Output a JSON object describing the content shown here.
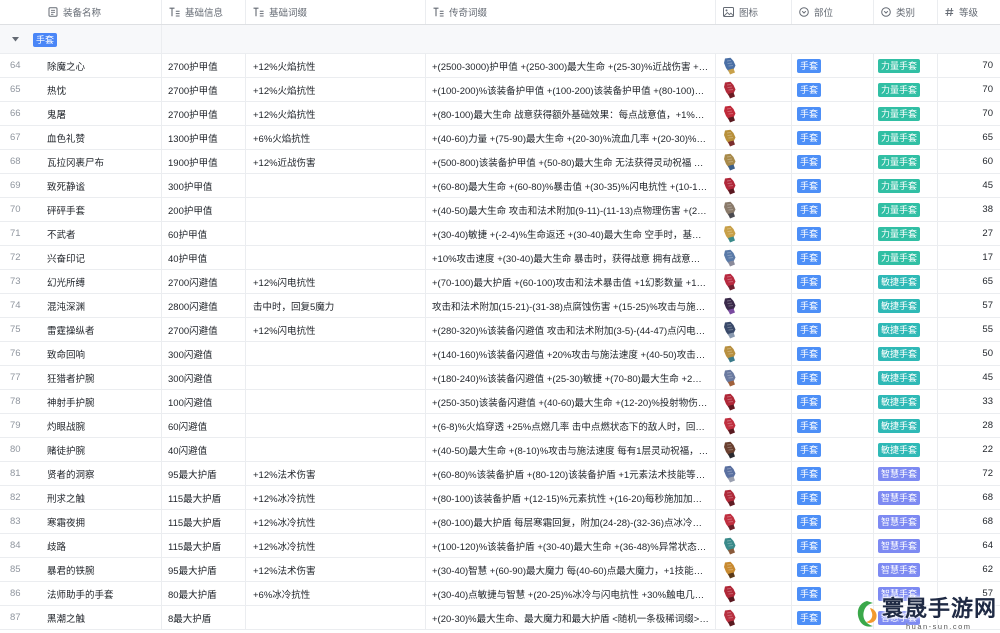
{
  "header": {
    "columns": [
      {
        "label": "装备名称",
        "icon": "primary-field-icon"
      },
      {
        "label": "基础信息",
        "icon": "text-field-icon"
      },
      {
        "label": "基础词缀",
        "icon": "text-field-icon"
      },
      {
        "label": "传奇词缀",
        "icon": "text-field-icon"
      },
      {
        "label": "图标",
        "icon": "image-field-icon"
      },
      {
        "label": "部位",
        "icon": "single-select-icon"
      },
      {
        "label": "类别",
        "icon": "single-select-icon"
      },
      {
        "label": "等级",
        "icon": "number-field-icon"
      }
    ]
  },
  "group": {
    "label": "手套",
    "color": "#4a86f7"
  },
  "tag_colors": {
    "手套": "#4d8ff7",
    "力量手套": "#31bfa4",
    "敏捷手套": "#2fb9b6",
    "智慧手套": "#7d8af2"
  },
  "rows": [
    {
      "index": "64",
      "name": "除魔之心",
      "base_info": "2700护甲值",
      "base_affix": "+12%火焰抗性",
      "legend_affix": "+(2500-3000)护甲值 +(250-300)最大生命 +(25-30)%近战伤害 +(1…",
      "icon_colors": [
        "#4a6fa5",
        "#c9a14a"
      ],
      "slot": "手套",
      "category": "力量手套",
      "level": "70"
    },
    {
      "index": "65",
      "name": "热忱",
      "base_info": "2700护甲值",
      "base_affix": "+12%火焰抗性",
      "legend_affix": "+(100-200)%该装备护甲值 +(100-200)该装备护甲值 +(80-100)最…",
      "icon_colors": [
        "#b22a3a",
        "#6b1d24"
      ],
      "slot": "手套",
      "category": "力量手套",
      "level": "70"
    },
    {
      "index": "66",
      "name": "鬼屠",
      "base_info": "2700护甲值",
      "base_affix": "+12%火焰抗性",
      "legend_affix": "+(80-100)最大生命 战意获得额外基础效果：每点战意值，+1%技…",
      "icon_colors": [
        "#c02a3a",
        "#5a1a20"
      ],
      "slot": "手套",
      "category": "力量手套",
      "level": "70"
    },
    {
      "index": "67",
      "name": "血色礼赞",
      "base_info": "1300护甲值",
      "base_affix": "+6%火焰抗性",
      "legend_affix": "+(40-60)力量 +(75-90)最大生命 +(20-30)%流血几率 +(20-30)%流…",
      "icon_colors": [
        "#b8903a",
        "#7a2d2d"
      ],
      "slot": "手套",
      "category": "力量手套",
      "level": "65"
    },
    {
      "index": "68",
      "name": "瓦拉冈裹尸布",
      "base_info": "1900护甲值",
      "base_affix": "+12%近战伤害",
      "legend_affix": "+(500-800)该装备护甲值 +(50-80)最大生命 无法获得灵动祝福 每…",
      "icon_colors": [
        "#a88a4a",
        "#3b5f8a"
      ],
      "slot": "手套",
      "category": "力量手套",
      "level": "60"
    },
    {
      "index": "69",
      "name": "致死静谧",
      "base_info": "300护甲值",
      "base_affix": "",
      "legend_affix": "+(60-80)最大生命 +(60-80)%暴击值 +(30-35)%闪电抗性 +(10-15)…",
      "icon_colors": [
        "#b0283a",
        "#5b1820"
      ],
      "slot": "手套",
      "category": "力量手套",
      "level": "45"
    },
    {
      "index": "70",
      "name": "砰砰手套",
      "base_info": "200护甲值",
      "base_affix": "",
      "legend_affix": "+(40-50)最大生命 攻击和法术附加(9-11)-(11-13)点物理伤害 +(20-…",
      "icon_colors": [
        "#8a7a6a",
        "#4a4a50"
      ],
      "slot": "手套",
      "category": "力量手套",
      "level": "38"
    },
    {
      "index": "71",
      "name": "不武者",
      "base_info": "60护甲值",
      "base_affix": "",
      "legend_affix": "+(30-40)敏捷 +(-2-4)%生命返还 +(30-40)最大生命 空手时，基础攻…",
      "icon_colors": [
        "#c8a048",
        "#3a8a8a"
      ],
      "slot": "手套",
      "category": "力量手套",
      "level": "27"
    },
    {
      "index": "72",
      "name": "兴奋印记",
      "base_info": "40护甲值",
      "base_affix": "",
      "legend_affix": "+10%攻击速度 +(30-40)最大生命 暴击时，获得战意 拥有战意时，…",
      "icon_colors": [
        "#5a7aa8",
        "#8a8a9a"
      ],
      "slot": "手套",
      "category": "力量手套",
      "level": "17"
    },
    {
      "index": "73",
      "name": "幻光所缚",
      "base_info": "2700闪避值",
      "base_affix": "+12%闪电抗性",
      "legend_affix": "+(70-100)最大护盾 +(60-100)攻击和法术暴击值 +1幻影数量 +100…",
      "icon_colors": [
        "#b82a40",
        "#702030"
      ],
      "slot": "手套",
      "category": "敏捷手套",
      "level": "65"
    },
    {
      "index": "74",
      "name": "混沌深渊",
      "base_info": "2800闪避值",
      "base_affix": "击中时，回复5魔力",
      "legend_affix": "攻击和法术附加(15-21)-(31-38)点腐蚀伤害 +(15-25)%攻击与施法…",
      "icon_colors": [
        "#3a2a4a",
        "#7a4aa0"
      ],
      "slot": "手套",
      "category": "敏捷手套",
      "level": "57"
    },
    {
      "index": "75",
      "name": "雷霆操纵者",
      "base_info": "2700闪避值",
      "base_affix": "+12%闪电抗性",
      "legend_affix": "+(280-320)%该装备闪避值 攻击和法术附加(3-5)-(44-47)点闪电伤…",
      "icon_colors": [
        "#3a4a6a",
        "#8a9ab0"
      ],
      "slot": "手套",
      "category": "敏捷手套",
      "level": "55"
    },
    {
      "index": "76",
      "name": "致命回响",
      "base_info": "300闪避值",
      "base_affix": "",
      "legend_affix": "+(140-160)%该装备闪避值 +20%攻击与施法速度 +(40-50)攻击和…",
      "icon_colors": [
        "#b89040",
        "#3a7a8a"
      ],
      "slot": "手套",
      "category": "敏捷手套",
      "level": "50"
    },
    {
      "index": "77",
      "name": "狂猎者护腕",
      "base_info": "300闪避值",
      "base_affix": "",
      "legend_affix": "+(180-240)%该装备闪避值 +(25-30)敏捷 +(70-80)最大生命 +2%生…",
      "icon_colors": [
        "#6a7aa0",
        "#a0603a"
      ],
      "slot": "手套",
      "category": "敏捷手套",
      "level": "45"
    },
    {
      "index": "78",
      "name": "神射手护腕",
      "base_info": "100闪避值",
      "base_affix": "",
      "legend_affix": "+(250-350)该装备闪避值 +(40-60)最大生命 +(12-20)%投射物伤害 …",
      "icon_colors": [
        "#b02838",
        "#601820"
      ],
      "slot": "手套",
      "category": "敏捷手套",
      "level": "33"
    },
    {
      "index": "79",
      "name": "灼眼战腕",
      "base_info": "60闪避值",
      "base_affix": "",
      "legend_affix": "+(6-8)%火焰穿透 +25%点燃几率 击中点燃状态下的敌人时，回复…",
      "icon_colors": [
        "#c03040",
        "#5a1a20"
      ],
      "slot": "手套",
      "category": "敏捷手套",
      "level": "28"
    },
    {
      "index": "80",
      "name": "赌徒护腕",
      "base_info": "40闪避值",
      "base_affix": "",
      "legend_affix": "+(40-50)最大生命 +(8-10)%攻击与施法速度 每有1层灵动祝福，…",
      "icon_colors": [
        "#6a4030",
        "#2a2a30"
      ],
      "slot": "手套",
      "category": "敏捷手套",
      "level": "22"
    },
    {
      "index": "81",
      "name": "贤者的洞察",
      "base_info": "95最大护盾",
      "base_affix": "+12%法术伤害",
      "legend_affix": "+(60-80)%该装备护盾 +(80-120)该装备护盾 +1元素法术技能等级 …",
      "icon_colors": [
        "#5a70a0",
        "#9aa0b0"
      ],
      "slot": "手套",
      "category": "智慧手套",
      "level": "72"
    },
    {
      "index": "82",
      "name": "刑求之触",
      "base_info": "115最大护盾",
      "base_affix": "+12%冰冷抗性",
      "legend_affix": "+(80-100)该装备护盾 +(12-15)%元素抗性 +(16-20)每秒施加加剧…",
      "icon_colors": [
        "#b02a3a",
        "#601c24"
      ],
      "slot": "手套",
      "category": "智慧手套",
      "level": "68"
    },
    {
      "index": "83",
      "name": "寒霜夜拥",
      "base_info": "115最大护盾",
      "base_affix": "+12%冰冷抗性",
      "legend_affix": "+(80-100)最大护盾 每层寒霜回复，附加(24-28)-(32-36)点冰冷基础…",
      "icon_colors": [
        "#c03040",
        "#6a2028"
      ],
      "slot": "手套",
      "category": "智慧手套",
      "level": "68"
    },
    {
      "index": "84",
      "name": "歧路",
      "base_info": "115最大护盾",
      "base_affix": "+12%冰冷抗性",
      "legend_affix": "+(100-120)%该装备护盾 +(30-40)最大生命 +(36-48)%异常状态持…",
      "icon_colors": [
        "#3a8a8a",
        "#8a5a3a"
      ],
      "slot": "手套",
      "category": "智慧手套",
      "level": "64"
    },
    {
      "index": "85",
      "name": "暴君的铁腕",
      "base_info": "95最大护盾",
      "base_affix": "+12%法术伤害",
      "legend_affix": "+(30-40)智慧 +(60-90)最大魔力 每(40-60)点最大魔力，+1技能魔…",
      "icon_colors": [
        "#c88a30",
        "#5a3a1a"
      ],
      "slot": "手套",
      "category": "智慧手套",
      "level": "62"
    },
    {
      "index": "86",
      "name": "法师助手的手套",
      "base_info": "80最大护盾",
      "base_affix": "+6%冰冷抗性",
      "legend_affix": "+(30-40)点敏捷与智慧 +(20-25)%冰冷与闪电抗性 +30%触电几率 …",
      "icon_colors": [
        "#b02838",
        "#5a1820"
      ],
      "slot": "手套",
      "category": "智慧手套",
      "level": "57"
    },
    {
      "index": "87",
      "name": "黑潮之触",
      "base_info": "8最大护盾",
      "base_affix": "",
      "legend_affix": "+(20-30)%最大生命、最大魔力和最大护盾 <随机一条极稀词缀> <…",
      "icon_colors": [
        "#b83040",
        "#5a1a20"
      ],
      "slot": "手套",
      "category": "智慧手套",
      "level": ""
    }
  ],
  "watermark": {
    "name": "寰晟手游网",
    "domain": "huan-sun.com"
  }
}
